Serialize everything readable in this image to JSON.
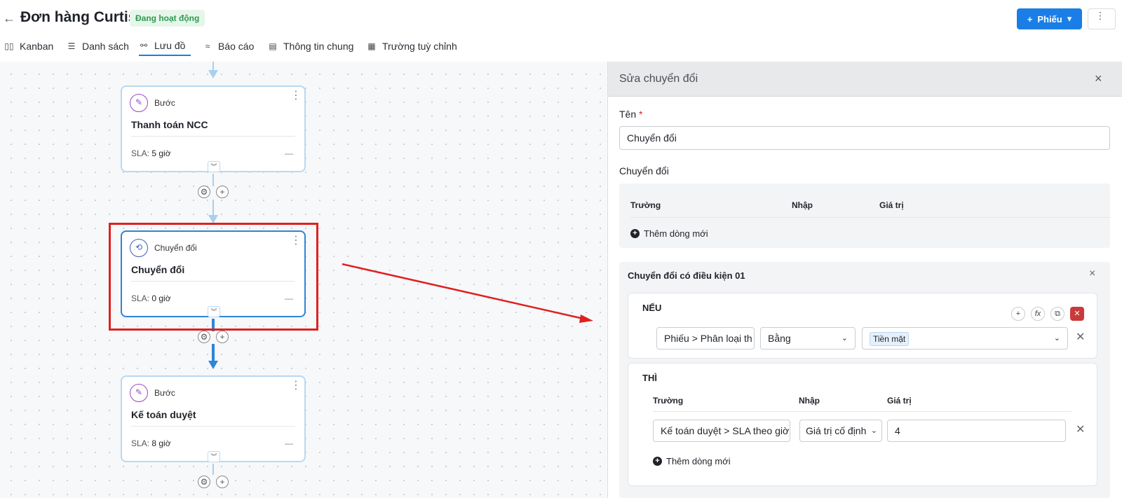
{
  "header": {
    "back_icon": "←",
    "title": "Đơn hàng Curtis",
    "status": "Đang hoạt động",
    "new_button": "Phiếu",
    "new_button_plus": "+",
    "new_button_caret": "▾",
    "more_icon": "⋮"
  },
  "tabs": [
    {
      "label": "Kanban",
      "icon": "▯▯"
    },
    {
      "label": "Danh sách",
      "icon": "☰"
    },
    {
      "label": "Lưu đồ",
      "icon": "⚯",
      "active": true
    },
    {
      "label": "Báo cáo",
      "icon": "≈"
    },
    {
      "label": "Thông tin chung",
      "icon": "▤"
    },
    {
      "label": "Trường tuỳ chỉnh",
      "icon": "▦"
    }
  ],
  "flow": {
    "nodes": [
      {
        "type": "Bước",
        "name": "Thanh toán NCC",
        "sla_label": "SLA:",
        "sla_value": "5 giờ",
        "dash": "—",
        "icon": "✎"
      },
      {
        "type": "Chuyển đổi",
        "name": "Chuyển đổi",
        "sla_label": "SLA:",
        "sla_value": "0 giờ",
        "dash": "—",
        "icon": "⟲"
      },
      {
        "type": "Bước",
        "name": "Kế toán duyệt",
        "sla_label": "SLA:",
        "sla_value": "8 giờ",
        "dash": "—",
        "icon": "✎"
      }
    ],
    "menu_icon": "⋮",
    "expand_icon": "︾",
    "gear_icon": "⚙",
    "add_icon": "+"
  },
  "panel": {
    "title": "Sửa chuyển đổi",
    "close_icon": "×",
    "name_label": "Tên",
    "required_mark": "*",
    "name_value": "Chuyển đổi",
    "section_label": "Chuyển đổi",
    "table_headers": [
      "Trường",
      "Nhập",
      "Giá trị"
    ],
    "add_row": "Thêm dòng mới",
    "condition": {
      "title": "Chuyển đổi có điều kiện 01",
      "if_label": "NẾU",
      "if_field": "Phiếu > Phân loại th",
      "if_operator": "Bằng",
      "if_value_tag": "Tiền mặt",
      "then_label": "THÌ",
      "then_headers": [
        "Trường",
        "Nhập",
        "Giá trị"
      ],
      "then_field": "Kế toán duyệt > SLA theo giờ",
      "then_input": "Giá trị cố định",
      "then_value": "4",
      "add_row": "Thêm dòng mới",
      "tools": [
        "+",
        "fx",
        "⧉",
        "✕"
      ]
    },
    "remove_icon": "✕"
  },
  "colors": {
    "accent": "#1a7ee6",
    "highlight": "#e02020",
    "status_bg": "#e6f6ea",
    "status_text": "#2e9a4f"
  }
}
